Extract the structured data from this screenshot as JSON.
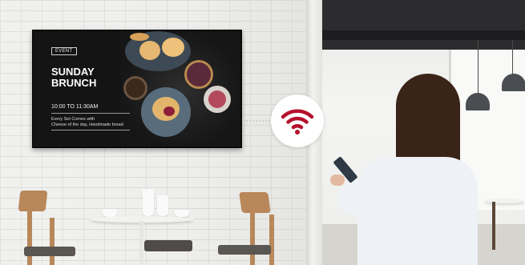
{
  "signage": {
    "badge": "EVENT",
    "title_line1": "SUNDAY",
    "title_line2": "BRUNCH",
    "time": "10:00 TO 11:30AM",
    "description_line1": "Every Set Comes with",
    "description_line2": "Cheese of the day, Handmade bread"
  },
  "wifi": {
    "icon": "wifi-icon",
    "color": "#b5122d"
  }
}
